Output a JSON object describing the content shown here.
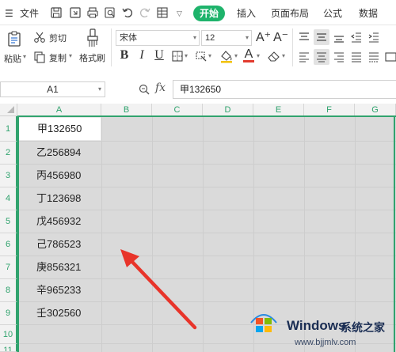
{
  "menubar": {
    "file_label": "文件",
    "tabs": [
      {
        "label": "开始",
        "active": true
      },
      {
        "label": "插入"
      },
      {
        "label": "页面布局"
      },
      {
        "label": "公式"
      },
      {
        "label": "数据"
      }
    ],
    "accent_color": "#1eb36b"
  },
  "ribbon": {
    "paste_label": "粘贴",
    "cut_label": "剪切",
    "copy_label": "复制",
    "format_painter_label": "格式刷",
    "font_name": "宋体",
    "font_size": "12",
    "font_buttons": [
      "B",
      "I",
      "U"
    ],
    "grow_font_glyph": "A⁺",
    "shrink_font_glyph": "A⁻",
    "font_color_glyph": "A"
  },
  "formula_bar": {
    "name_box": "A1",
    "fx_label": "fx",
    "formula_value": "甲132650"
  },
  "sheet": {
    "columns": [
      "A",
      "B",
      "C",
      "D",
      "E",
      "F",
      "G"
    ],
    "rows": [
      "1",
      "2",
      "3",
      "4",
      "5",
      "6",
      "7",
      "8",
      "9",
      "10",
      "11"
    ],
    "cells_a": [
      "甲132650",
      "乙256894",
      "丙456980",
      "丁123698",
      "戊456932",
      "己786523",
      "庚856321",
      "辛965233",
      "壬302560"
    ],
    "selected_cell": "A1",
    "header_color": "#31a36e"
  },
  "watermark": {
    "title": "Windows",
    "subtitle": "系统之家",
    "url": "www.bjjmlv.com"
  }
}
